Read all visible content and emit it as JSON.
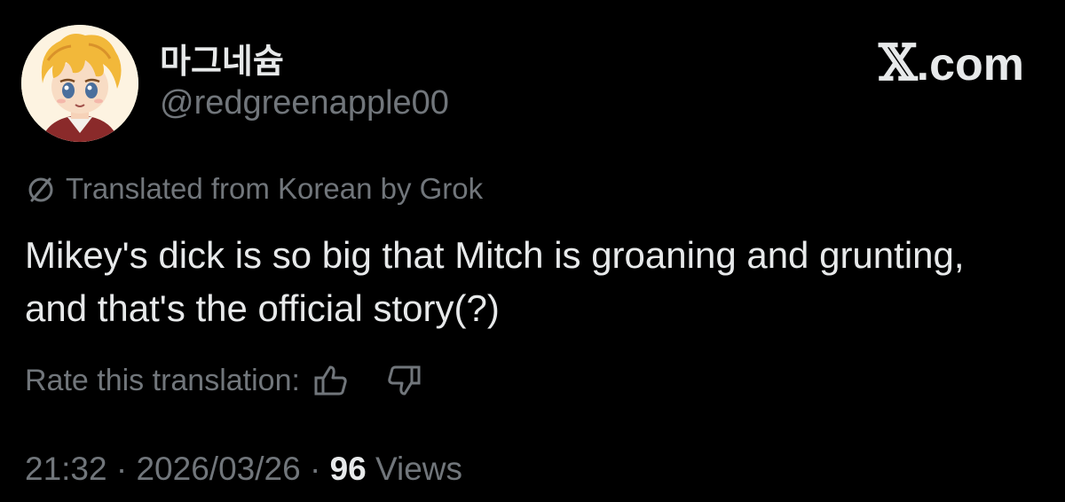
{
  "author": {
    "display_name": "마그네슘",
    "handle": "@redgreenapple00"
  },
  "brand": {
    "x_mark": "𝕏",
    "suffix": ".com"
  },
  "translation": {
    "notice": "Translated from Korean by Grok",
    "icon": "translate-icon"
  },
  "tweet": {
    "text": "Mikey's dick is so big that Mitch is groaning and grunting, and that's the official story(?)"
  },
  "rating": {
    "label": "Rate this translation:",
    "up_icon": "thumbs-up-icon",
    "down_icon": "thumbs-down-icon"
  },
  "meta": {
    "time": "21:32",
    "sep1": " · ",
    "date": "2026/03/26",
    "sep2": " · ",
    "views_count": "96",
    "views_label": " Views"
  },
  "colors": {
    "background": "#000000",
    "primary_text": "#e7e9ea",
    "secondary_text": "#71767b"
  }
}
